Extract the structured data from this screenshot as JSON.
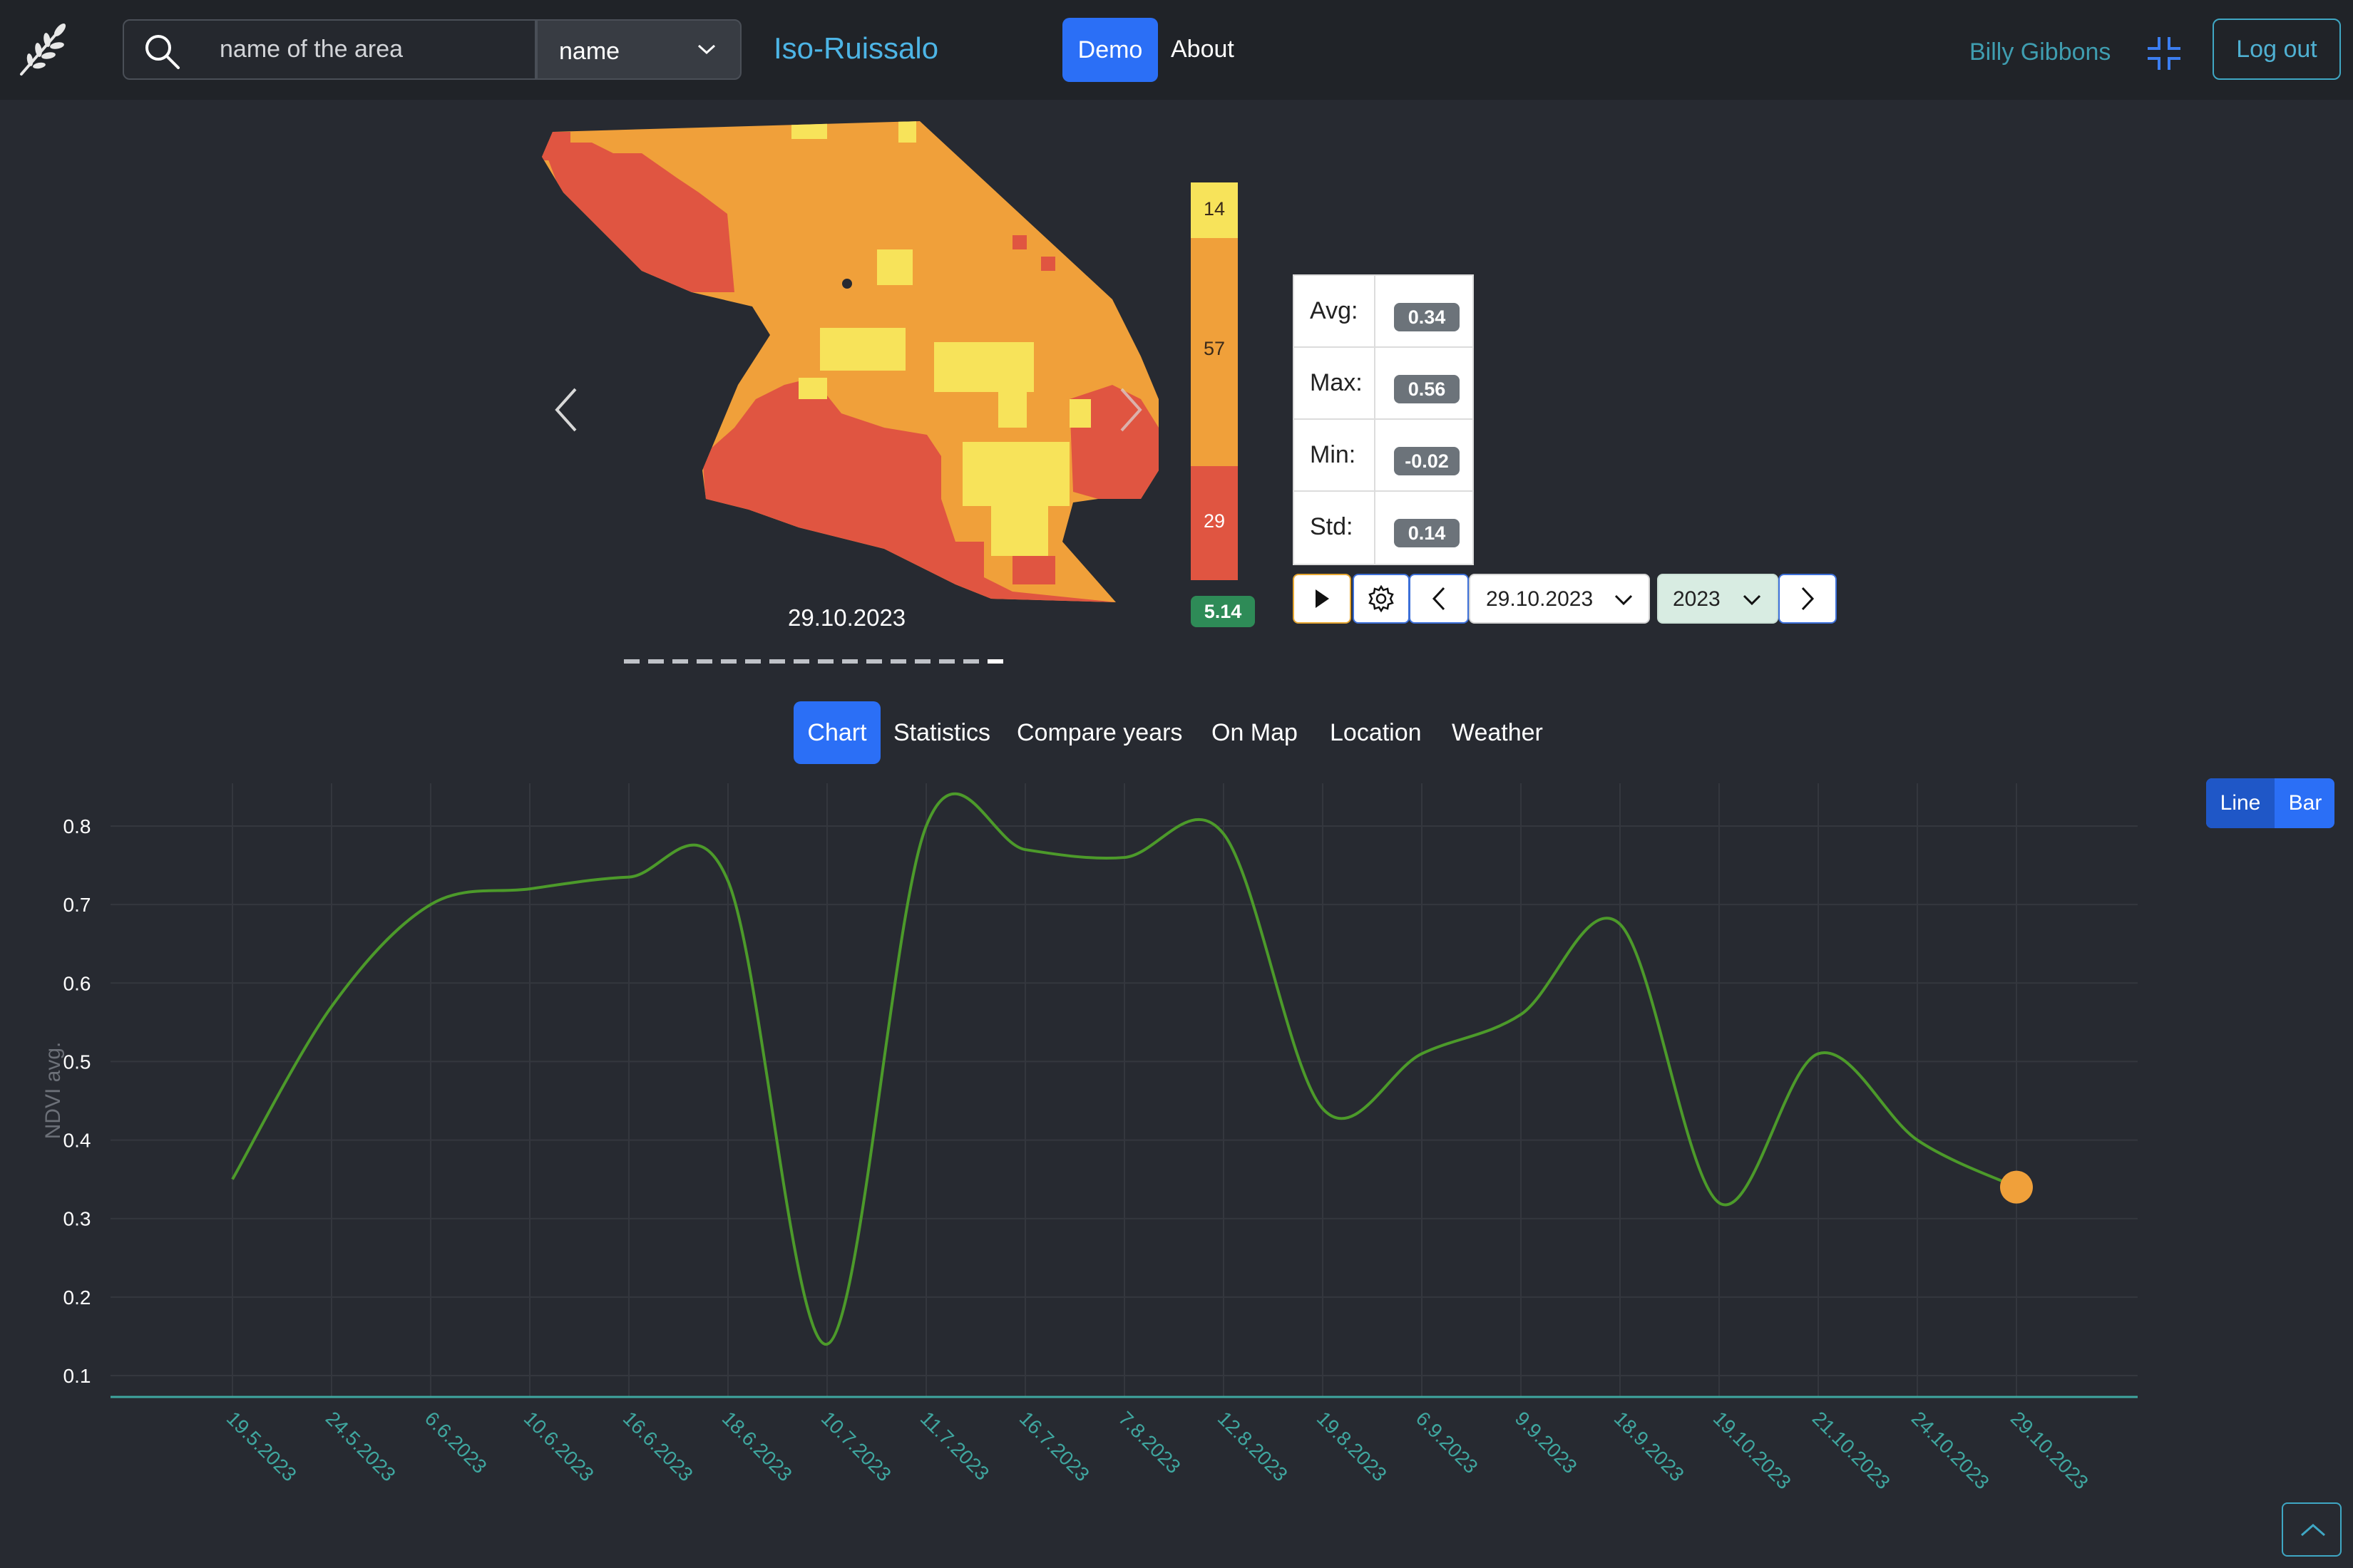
{
  "navbar": {
    "search_placeholder": "name of the area",
    "search_by": "name",
    "area_title": "Iso-Ruissalo",
    "demo_label": "Demo",
    "about_label": "About",
    "user_name": "Billy Gibbons",
    "logout_label": "Log out"
  },
  "image_viewer": {
    "date": "29.10.2023",
    "slide_count": 16,
    "active_slide": 16
  },
  "legend": {
    "segments": [
      {
        "label": "14",
        "color": "#f7e35a"
      },
      {
        "label": "57",
        "color": "#f0a03a"
      },
      {
        "label": "29",
        "color": "#e05541"
      }
    ],
    "total": "5.14"
  },
  "stats": [
    {
      "key": "Avg:",
      "value": "0.34"
    },
    {
      "key": "Max:",
      "value": "0.56"
    },
    {
      "key": "Min:",
      "value": "-0.02"
    },
    {
      "key": "Std:",
      "value": "0.14"
    }
  ],
  "controls": {
    "date_value": "29.10.2023",
    "year_value": "2023"
  },
  "tabs": [
    {
      "label": "Chart",
      "active": true
    },
    {
      "label": "Statistics",
      "active": false
    },
    {
      "label": "Compare years",
      "active": false
    },
    {
      "label": "On Map",
      "active": false
    },
    {
      "label": "Location",
      "active": false
    },
    {
      "label": "Weather",
      "active": false
    }
  ],
  "chart_toggle": {
    "line_label": "Line",
    "bar_label": "Bar",
    "selected": "Line"
  },
  "colors": {
    "accent": "#2b6ff6",
    "line": "#4c9a2a",
    "highlight_point": "#f0a03a",
    "axis_text": "#3fa7a0"
  },
  "chart_data": {
    "type": "line",
    "ylabel": "NDVI avg.",
    "xlabel": "",
    "ylim": [
      0.08,
      0.86
    ],
    "yticks": [
      0.1,
      0.2,
      0.3,
      0.4,
      0.5,
      0.6,
      0.7,
      0.8
    ],
    "grid": true,
    "categories": [
      "19.5.2023",
      "24.5.2023",
      "6.6.2023",
      "10.6.2023",
      "16.6.2023",
      "18.6.2023",
      "10.7.2023",
      "11.7.2023",
      "16.7.2023",
      "7.8.2023",
      "12.8.2023",
      "19.8.2023",
      "6.9.2023",
      "9.9.2023",
      "18.9.2023",
      "19.10.2023",
      "21.10.2023",
      "24.10.2023",
      "29.10.2023"
    ],
    "series": [
      {
        "values": [
          0.35,
          0.57,
          0.7,
          0.72,
          0.735,
          0.73,
          0.14,
          0.8,
          0.77,
          0.76,
          0.79,
          0.44,
          0.51,
          0.56,
          0.675,
          0.32,
          0.51,
          0.4,
          0.34
        ]
      }
    ],
    "highlight_index": 18
  }
}
